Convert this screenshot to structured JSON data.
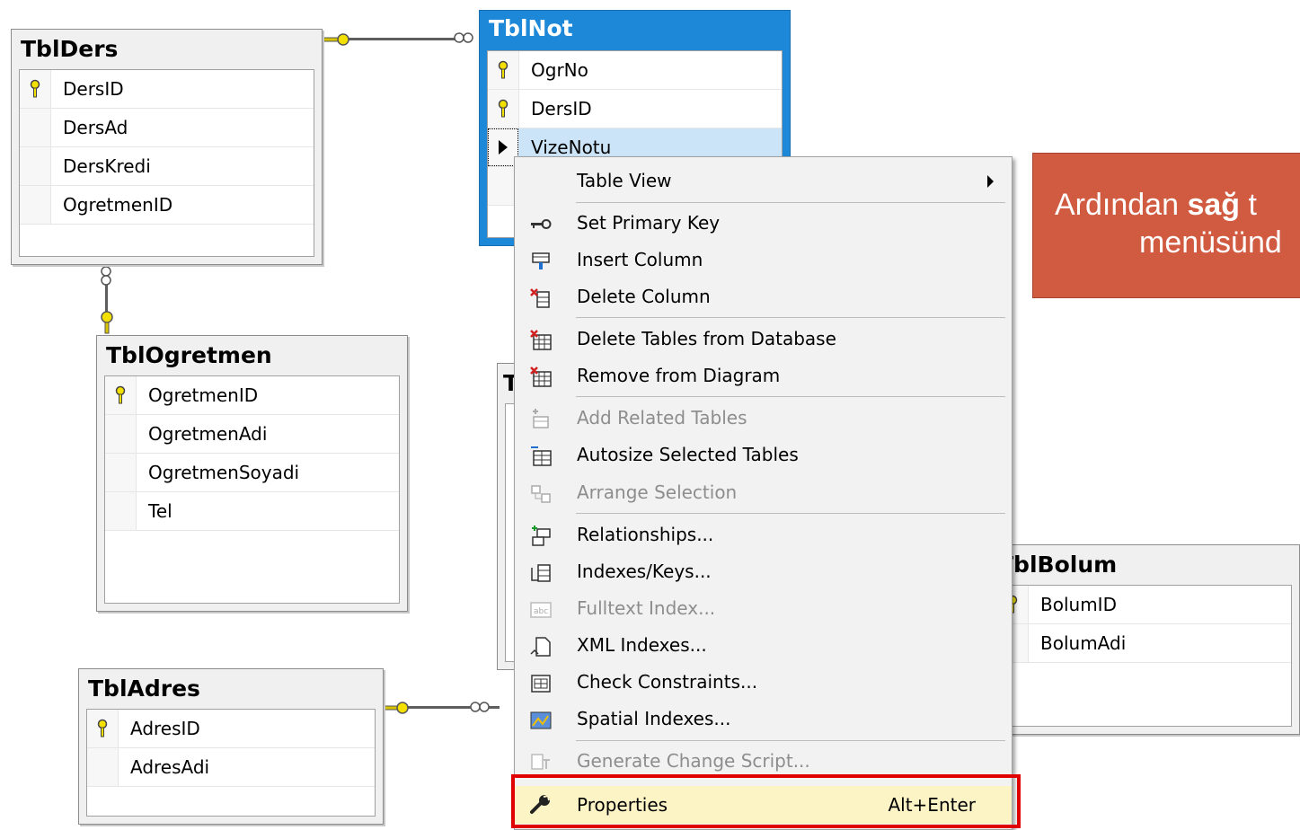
{
  "tables": {
    "tblders": {
      "title": "TblDers",
      "rows": [
        "DersID",
        "DersAd",
        "DersKredi",
        "OgretmenID"
      ]
    },
    "tblnot": {
      "title": "TblNot",
      "rows": [
        "OgrNo",
        "DersID",
        "VizeNotu"
      ]
    },
    "tblogretmen": {
      "title": "TblOgretmen",
      "rows": [
        "OgretmenID",
        "OgretmenAdi",
        "OgretmenSoyadi",
        "Tel"
      ]
    },
    "tbladres": {
      "title": "TblAdres",
      "rows": [
        "AdresID",
        "AdresAdi"
      ]
    },
    "tblbolum": {
      "title": "TblBolum",
      "rows": [
        "BolumID",
        "BolumAdi"
      ]
    },
    "hidden_table_initial": "T"
  },
  "context_menu": {
    "items": [
      {
        "label": "Table View",
        "icon": "none",
        "submenu": true
      },
      {
        "label": "Set Primary Key",
        "icon": "key-icon"
      },
      {
        "label": "Insert Column",
        "icon": "insert-column-icon"
      },
      {
        "label": "Delete Column",
        "icon": "delete-column-icon"
      },
      {
        "label": "Delete Tables from Database",
        "icon": "delete-table-icon"
      },
      {
        "label": "Remove from Diagram",
        "icon": "remove-table-icon"
      },
      {
        "label": "Add Related Tables",
        "icon": "add-related-icon",
        "disabled": true
      },
      {
        "label": "Autosize Selected Tables",
        "icon": "autosize-icon"
      },
      {
        "label": "Arrange Selection",
        "icon": "arrange-icon",
        "disabled": true
      },
      {
        "label": "Relationships...",
        "icon": "relationships-icon"
      },
      {
        "label": "Indexes/Keys...",
        "icon": "indexes-icon"
      },
      {
        "label": "Fulltext Index...",
        "icon": "fulltext-icon",
        "disabled": true
      },
      {
        "label": "XML Indexes...",
        "icon": "xml-icon"
      },
      {
        "label": "Check Constraints...",
        "icon": "check-icon"
      },
      {
        "label": "Spatial Indexes...",
        "icon": "spatial-icon"
      },
      {
        "label": "Generate Change Script...",
        "icon": "script-icon",
        "disabled": true
      },
      {
        "label": "Properties",
        "icon": "wrench-icon",
        "shortcut": "Alt+Enter"
      }
    ]
  },
  "callout": {
    "line1_prefix": "Ardından ",
    "line1_bold": "sağ",
    "line1_suffix": " t",
    "line2": "menüsünd"
  },
  "colors": {
    "highlight": "#e00000",
    "callout": "#d15b40",
    "selection": "#1e88d8"
  }
}
